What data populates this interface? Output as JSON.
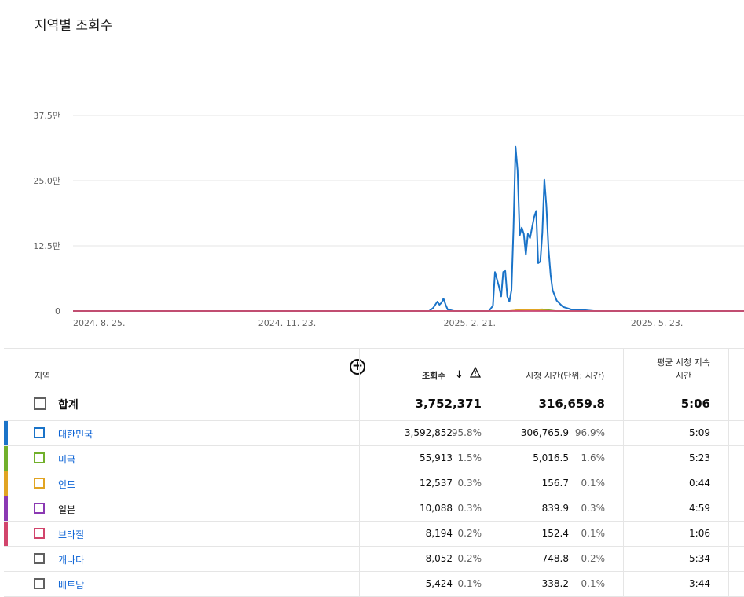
{
  "page_title": "지역별 조회수",
  "colors": {
    "korea": "#1a73c8",
    "usa": "#71b02b",
    "india": "#e1a422",
    "japan": "#8b39b3",
    "brazil": "#d2456c",
    "grid": "#e5e5e5"
  },
  "chart_data": {
    "type": "line",
    "title": "",
    "y_ticks": [
      "0",
      "12.5만",
      "25.0만",
      "37.5만"
    ],
    "ylim": [
      0,
      400000
    ],
    "x_ticks": [
      "2024. 8. 25.",
      "2024. 11. 23.",
      "2025. 2. 21.",
      "2025. 5. 23."
    ],
    "x_tick_dates": [
      "2024-08-25",
      "2024-11-23",
      "2025-02-21",
      "2025-05-23"
    ],
    "x_range": [
      "2024-08-25",
      "2025-07-17"
    ],
    "grid": true,
    "legend": "none",
    "series": [
      {
        "key": "korea",
        "points": [
          [
            "2024-08-25",
            0
          ],
          [
            "2025-02-14",
            0
          ],
          [
            "2025-02-16",
            6000
          ],
          [
            "2025-02-18",
            18000
          ],
          [
            "2025-02-19",
            12000
          ],
          [
            "2025-02-20",
            16000
          ],
          [
            "2025-02-21",
            24000
          ],
          [
            "2025-02-22",
            12000
          ],
          [
            "2025-02-23",
            3000
          ],
          [
            "2025-02-26",
            0
          ],
          [
            "2025-03-15",
            0
          ],
          [
            "2025-03-17",
            10000
          ],
          [
            "2025-03-18",
            75000
          ],
          [
            "2025-03-20",
            46000
          ],
          [
            "2025-03-21",
            28000
          ],
          [
            "2025-03-22",
            75000
          ],
          [
            "2025-03-23",
            77000
          ],
          [
            "2025-03-24",
            28000
          ],
          [
            "2025-03-25",
            18000
          ],
          [
            "2025-03-26",
            40000
          ],
          [
            "2025-03-27",
            160000
          ],
          [
            "2025-03-28",
            315000
          ],
          [
            "2025-03-29",
            270000
          ],
          [
            "2025-03-30",
            145000
          ],
          [
            "2025-03-31",
            160000
          ],
          [
            "2025-04-01",
            148000
          ],
          [
            "2025-04-02",
            108000
          ],
          [
            "2025-04-03",
            148000
          ],
          [
            "2025-04-04",
            140000
          ],
          [
            "2025-04-06",
            180000
          ],
          [
            "2025-04-07",
            192000
          ],
          [
            "2025-04-08",
            92000
          ],
          [
            "2025-04-09",
            95000
          ],
          [
            "2025-04-10",
            150000
          ],
          [
            "2025-04-11",
            252000
          ],
          [
            "2025-04-12",
            200000
          ],
          [
            "2025-04-13",
            120000
          ],
          [
            "2025-04-14",
            70000
          ],
          [
            "2025-04-15",
            40000
          ],
          [
            "2025-04-17",
            20000
          ],
          [
            "2025-04-20",
            8000
          ],
          [
            "2025-04-24",
            3000
          ],
          [
            "2025-05-01",
            1500
          ],
          [
            "2025-05-05",
            0
          ],
          [
            "2025-07-17",
            0
          ]
        ]
      },
      {
        "key": "usa",
        "points": [
          [
            "2024-08-25",
            0
          ],
          [
            "2025-03-26",
            0
          ],
          [
            "2025-03-28",
            1500
          ],
          [
            "2025-04-01",
            2500
          ],
          [
            "2025-04-05",
            3000
          ],
          [
            "2025-04-10",
            3500
          ],
          [
            "2025-04-14",
            1500
          ],
          [
            "2025-04-17",
            0
          ],
          [
            "2025-07-17",
            0
          ]
        ]
      },
      {
        "key": "india",
        "points": [
          [
            "2024-08-25",
            0
          ],
          [
            "2025-03-24",
            0
          ],
          [
            "2025-03-28",
            1500
          ],
          [
            "2025-04-02",
            2200
          ],
          [
            "2025-04-08",
            2000
          ],
          [
            "2025-04-13",
            800
          ],
          [
            "2025-04-16",
            0
          ],
          [
            "2025-07-17",
            0
          ]
        ]
      },
      {
        "key": "japan",
        "points": [
          [
            "2024-08-25",
            0
          ],
          [
            "2025-07-17",
            0
          ]
        ]
      },
      {
        "key": "brazil",
        "points": [
          [
            "2024-08-25",
            0
          ],
          [
            "2025-07-17",
            0
          ]
        ]
      }
    ]
  },
  "table": {
    "headers": {
      "region": "지역",
      "views": "조회수",
      "watch_time": "시청 시간(단위: 시간)",
      "avg_duration": "평균 시청 지속 시간"
    },
    "total": {
      "label": "합계",
      "views": "3,752,371",
      "watch_time": "316,659.8",
      "avg_duration": "5:06"
    },
    "rows": [
      {
        "color_key": "korea",
        "name": "대한민국",
        "link": true,
        "views": "3,592,852",
        "views_pct": "95.8%",
        "watch": "306,765.9",
        "watch_pct": "96.9%",
        "avg": "5:09"
      },
      {
        "color_key": "usa",
        "name": "미국",
        "link": true,
        "views": "55,913",
        "views_pct": "1.5%",
        "watch": "5,016.5",
        "watch_pct": "1.6%",
        "avg": "5:23"
      },
      {
        "color_key": "india",
        "name": "인도",
        "link": true,
        "views": "12,537",
        "views_pct": "0.3%",
        "watch": "156.7",
        "watch_pct": "0.1%",
        "avg": "0:44"
      },
      {
        "color_key": "japan",
        "name": "일본",
        "link": false,
        "views": "10,088",
        "views_pct": "0.3%",
        "watch": "839.9",
        "watch_pct": "0.3%",
        "avg": "4:59"
      },
      {
        "color_key": "brazil",
        "name": "브라질",
        "link": true,
        "views": "8,194",
        "views_pct": "0.2%",
        "watch": "152.4",
        "watch_pct": "0.1%",
        "avg": "1:06"
      },
      {
        "color_key": null,
        "name": "캐나다",
        "link": true,
        "views": "8,052",
        "views_pct": "0.2%",
        "watch": "748.8",
        "watch_pct": "0.2%",
        "avg": "5:34"
      },
      {
        "color_key": null,
        "name": "베트남",
        "link": true,
        "views": "5,424",
        "views_pct": "0.1%",
        "watch": "338.2",
        "watch_pct": "0.1%",
        "avg": "3:44"
      }
    ]
  }
}
